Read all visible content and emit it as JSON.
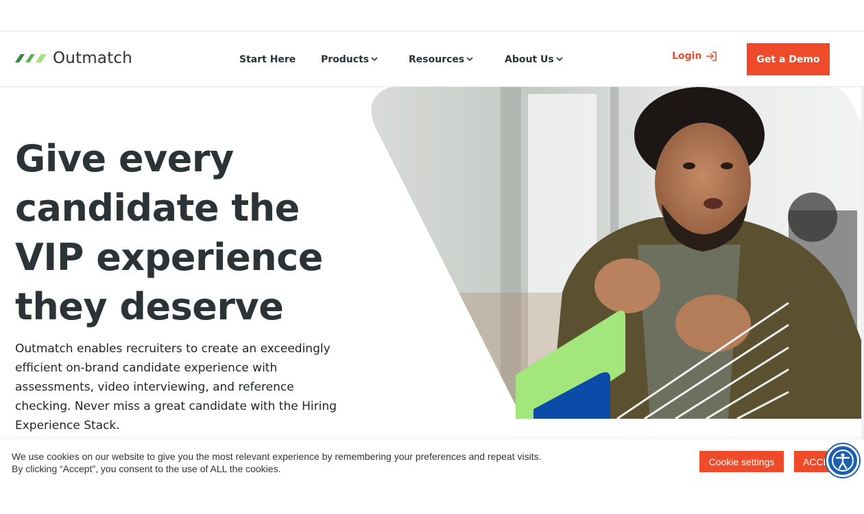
{
  "brand": {
    "name": "Outmatch",
    "logo_colors": [
      "#2e8b3e",
      "#7dc55a",
      "#a8e27c"
    ]
  },
  "nav": {
    "items": [
      {
        "label": "Start Here",
        "has_dropdown": false
      },
      {
        "label": "Products",
        "has_dropdown": true
      },
      {
        "label": "Resources",
        "has_dropdown": true
      },
      {
        "label": "About Us",
        "has_dropdown": true
      }
    ],
    "chevron_icon": "chevron-down-icon"
  },
  "login": {
    "label": "Login",
    "icon": "login-arrow-icon"
  },
  "cta": {
    "label": "Get a Demo"
  },
  "hero": {
    "headline_lines": [
      "Give every",
      "candidate the",
      "VIP experience",
      "they deserve"
    ],
    "subtext": "Outmatch enables recruiters to create an exceedingly efficient on-brand candidate experience with assessments, video interviewing, and reference checking. Never miss a great candidate with the Hiring Experience Stack."
  },
  "cookie_banner": {
    "text_line1": "We use cookies on our website to give you the most relevant experience by remembering your preferences and repeat visits.",
    "text_line2": "By clicking “Accept”, you consent to the use of ALL the cookies.",
    "settings_label": "Cookie settings",
    "accept_label": "ACCEPT"
  },
  "colors": {
    "accent": "#ef4a2a",
    "text": "#2b3336",
    "green_shape": "#a2e67c",
    "blue_shape": "#0a4ca8",
    "accessibility": "#1c5fb0"
  }
}
